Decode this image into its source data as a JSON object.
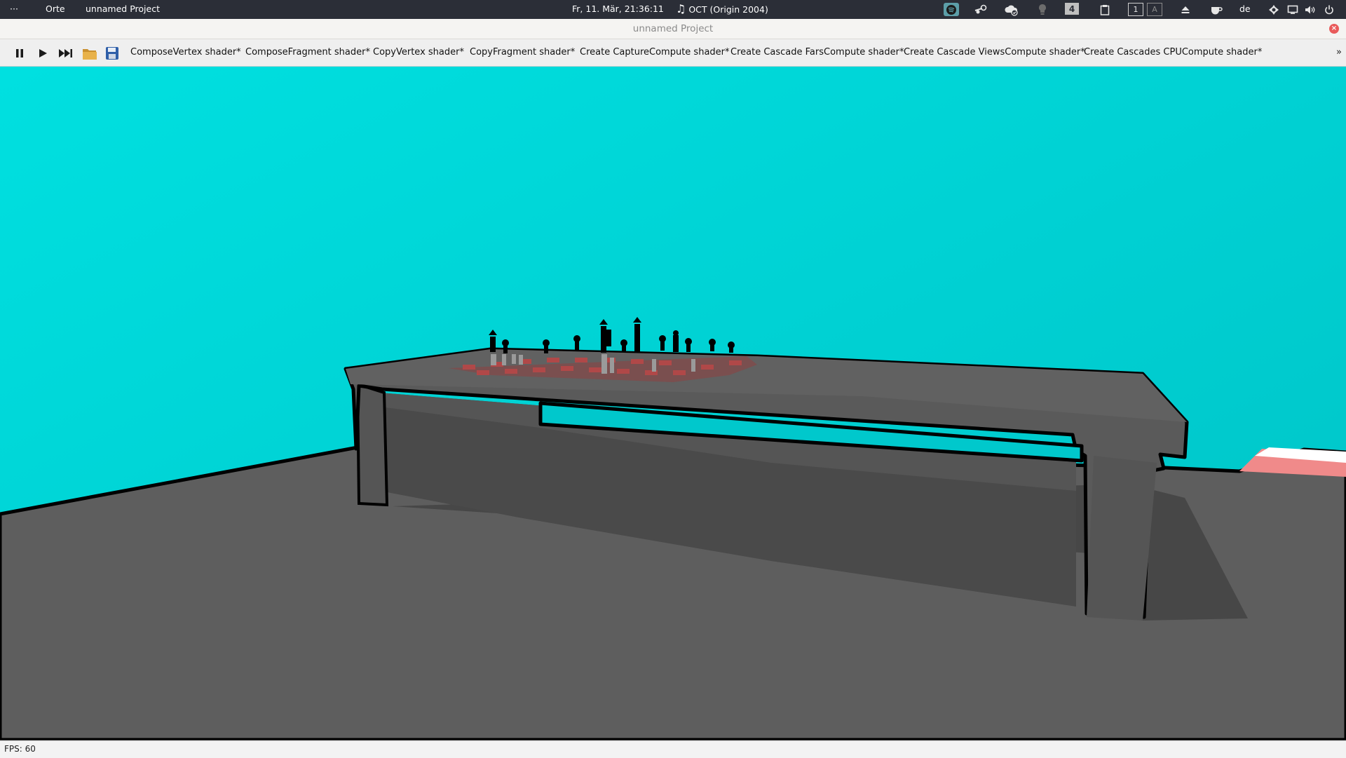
{
  "topbar": {
    "activities": "···",
    "places": "Orte",
    "app_name": "unnamed Project",
    "clock": "Fr, 11. Mär, 21:36:11",
    "media": "OCT (Origin 2004)",
    "workspace_number": "4",
    "keyboard_indicator_1": "1",
    "keyboard_indicator_2": "A",
    "language": "de",
    "tray_icons": [
      "spotify-icon",
      "steam-icon",
      "cloud-sync-icon",
      "lightbulb-icon",
      "workspace-indicator",
      "clipboard-icon",
      "eject-icon",
      "coffee-icon",
      "settings-icon",
      "display-icon",
      "volume-icon",
      "power-icon"
    ]
  },
  "window": {
    "title": "unnamed Project",
    "close_label": "×"
  },
  "toolbar": {
    "buttons": [
      "pause-icon",
      "play-icon",
      "step-forward-icon",
      "open-folder-icon",
      "save-icon"
    ],
    "shaders": [
      "ComposeVertex shader*",
      "ComposeFragment shader*",
      "CopyVertex shader*",
      "CopyFragment shader*",
      "Create CaptureCompute shader*",
      "Create Cascade FarsCompute shader*",
      "Create Cascade ViewsCompute shader*",
      "Create Cascades CPUCompute shader*"
    ],
    "overflow": "»"
  },
  "status": {
    "fps": "FPS: 60"
  },
  "colors": {
    "sky": "#00d8d8",
    "floor": "#5e5e5e",
    "table": "#5a5a5a",
    "outline": "#000000",
    "board_red": "#b04848",
    "accent_pink": "#f08a8a"
  }
}
